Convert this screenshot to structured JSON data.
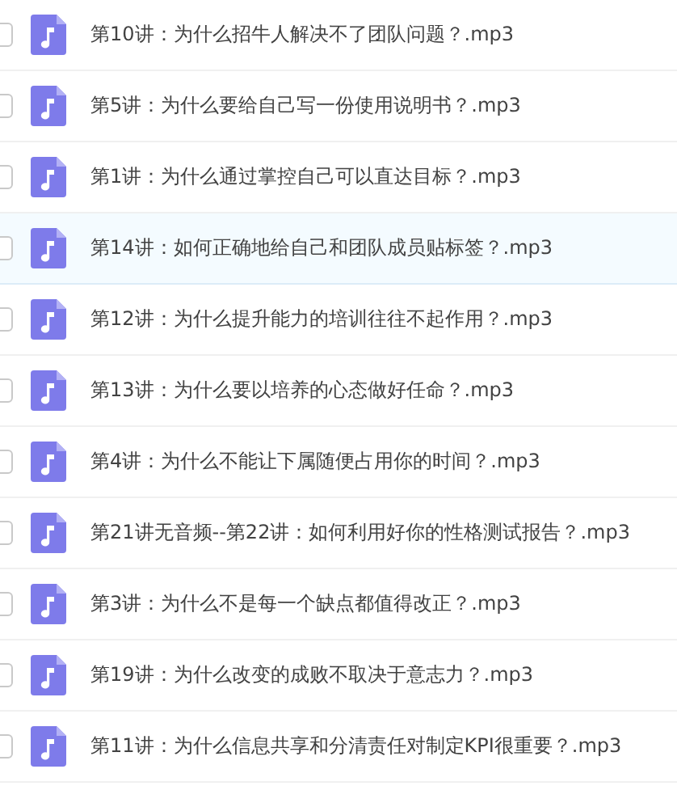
{
  "files": [
    {
      "name": "第10讲：为什么招牛人解决不了团队问题？.mp3",
      "selected": false,
      "checked": false
    },
    {
      "name": "第5讲：为什么要给自己写一份使用说明书？.mp3",
      "selected": false,
      "checked": false
    },
    {
      "name": "第1讲：为什么通过掌控自己可以直达目标？.mp3",
      "selected": false,
      "checked": false
    },
    {
      "name": "第14讲：如何正确地给自己和团队成员贴标签？.mp3",
      "selected": true,
      "checked": false
    },
    {
      "name": "第12讲：为什么提升能力的培训往往不起作用？.mp3",
      "selected": false,
      "checked": false
    },
    {
      "name": "第13讲：为什么要以培养的心态做好任命？.mp3",
      "selected": false,
      "checked": false
    },
    {
      "name": "第4讲：为什么不能让下属随便占用你的时间？.mp3",
      "selected": false,
      "checked": false
    },
    {
      "name": "第21讲无音频--第22讲：如何利用好你的性格测试报告？.mp3",
      "selected": false,
      "checked": false
    },
    {
      "name": "第3讲：为什么不是每一个缺点都值得改正？.mp3",
      "selected": false,
      "checked": false
    },
    {
      "name": "第19讲：为什么改变的成败不取决于意志力？.mp3",
      "selected": false,
      "checked": false
    },
    {
      "name": "第11讲：为什么信息共享和分清责任对制定KPI很重要？.mp3",
      "selected": false,
      "checked": false
    }
  ]
}
